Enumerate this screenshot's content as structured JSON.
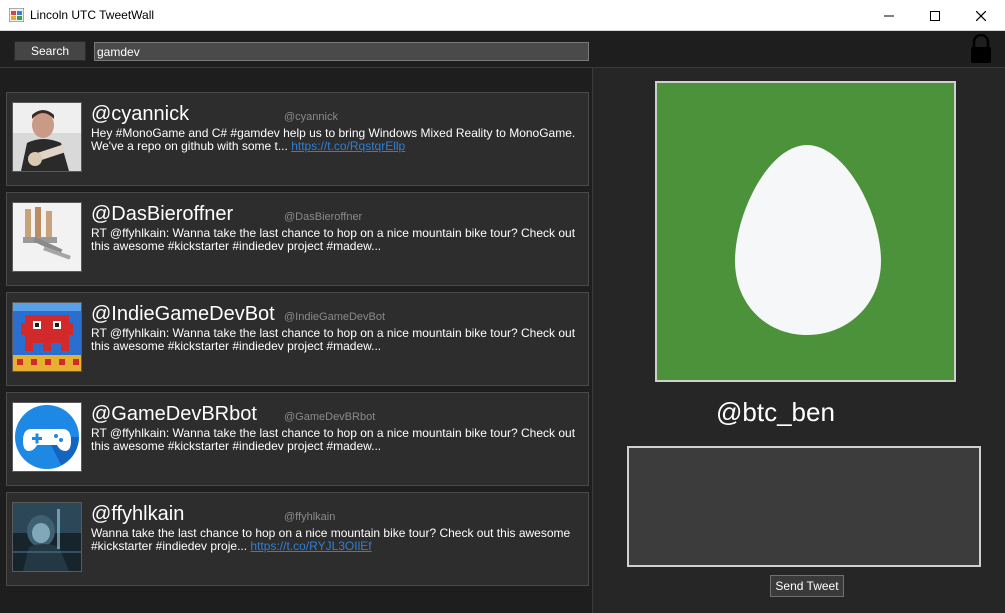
{
  "window": {
    "title": "Lincoln UTC TweetWall",
    "controls": [
      "minimize-icon",
      "maximize-icon",
      "close-icon"
    ]
  },
  "toolbar": {
    "search_label": "Search",
    "search_value": "gamdev",
    "lock_icon": "lock-icon"
  },
  "tweets": [
    {
      "name": "@cyannick",
      "handle": "@cyannick",
      "text": "Hey #MonoGame and C# #gamdev help us to bring Windows Mixed Reality to MonoGame. We've a repo on github with some t...",
      "link": "https://t.co/RqstqrEllp",
      "avatar": "person-with-guitar"
    },
    {
      "name": "@DasBieroffner",
      "handle": "@DasBieroffner",
      "text": "RT @ffyhlkain: Wanna take the last chance to hop on a nice mountain bike tour? Check out this awesome #kickstarter #indiedev project #madew...",
      "link": "",
      "avatar": "bottle-openers"
    },
    {
      "name": "@IndieGameDevBot",
      "handle": "@IndieGameDevBot",
      "text": "RT @ffyhlkain: Wanna take the last chance to hop on a nice mountain bike tour? Check out this awesome #kickstarter #indiedev project #madew...",
      "link": "",
      "avatar": "pixel-invader"
    },
    {
      "name": "@GameDevBRbot",
      "handle": "@GameDevBRbot",
      "text": "RT @ffyhlkain: Wanna take the last chance to hop on a nice mountain bike tour? Check out this awesome #kickstarter #indiedev project #madew...",
      "link": "",
      "avatar": "gamepad-icon"
    },
    {
      "name": "@ffyhlkain",
      "handle": "@ffyhlkain",
      "text": "Wanna take the last chance to hop on a nice mountain bike tour? Check out this awesome #kickstarter #indiedev proje...",
      "link": "https://t.co/RYJL3OIlEf",
      "avatar": "dark-armored-figure"
    }
  ],
  "profile": {
    "username": "@btc_ben",
    "avatar": "default-egg-avatar",
    "tweet_input_value": "",
    "send_label": "Send Tweet"
  },
  "colors": {
    "background": "#1e1e1e",
    "tweet_card": "#2d2d2d",
    "link": "#2f7fd6",
    "egg_green": "#4c923b"
  }
}
